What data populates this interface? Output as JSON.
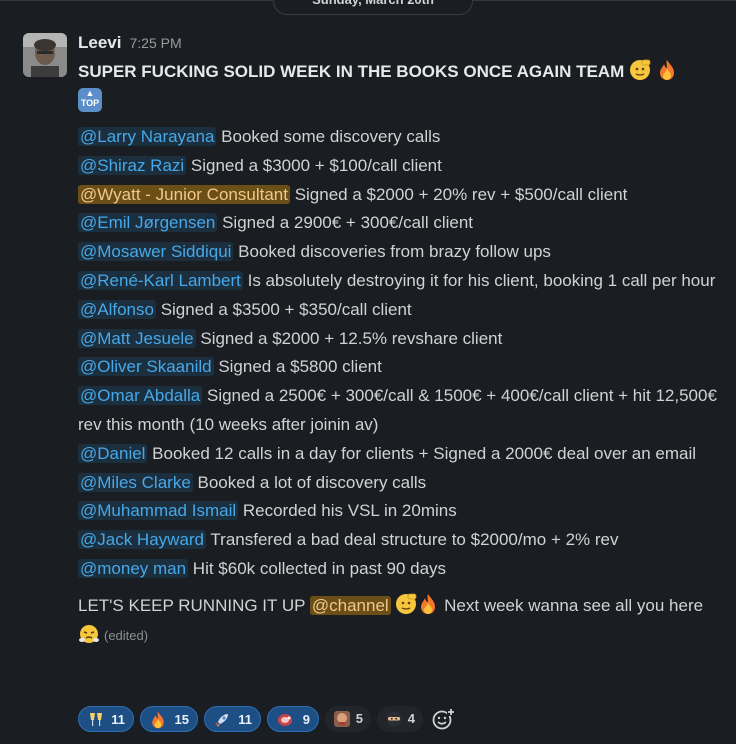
{
  "date_divider": "Sunday, March 20th",
  "message": {
    "author": "Leevi",
    "timestamp": "7:25 PM",
    "headline": "SUPER FUCKING SOLID WEEK IN THE BOOKS ONCE AGAIN TEAM",
    "headline_emojis": [
      "saluting-face",
      "fire",
      "top-arrow"
    ],
    "top_badge": "TOP",
    "items": [
      {
        "mention": "@Larry Narayana",
        "text": " Booked some discovery calls"
      },
      {
        "mention": "@Shiraz Razi",
        "text": " Signed a $3000 + $100/call client"
      },
      {
        "mention": "@Wyatt - Junior Consultant",
        "text": " Signed a $2000 + 20% rev + $500/call client",
        "highlight": true
      },
      {
        "mention": "@Emil Jørgensen",
        "text": " Signed a 2900€ + 300€/call client"
      },
      {
        "mention": "@Mosawer Siddiqui",
        "text": " Booked discoveries from brazy follow ups"
      },
      {
        "mention": "@René-Karl Lambert",
        "text": " Is absolutely destroying it for his client, booking 1 call per hour"
      },
      {
        "mention": "@Alfonso",
        "text": " Signed a $3500 + $350/call client"
      },
      {
        "mention": "@Matt Jesuele",
        "text": " Signed a $2000 + 12.5% revshare client"
      },
      {
        "mention": "@Oliver Skaanild",
        "text": " Signed a $5800 client"
      },
      {
        "mention": "@Omar Abdalla",
        "text": " Signed a 2500€ + 300€/call & 1500€ + 400€/call client + hit 12,500€ rev this month (10 weeks after joinin av)"
      },
      {
        "mention": "@Daniel",
        "text": " Booked 12 calls in a day for clients + Signed a 2000€ deal over an email"
      },
      {
        "mention": "@Miles Clarke",
        "text": " Booked a lot of discovery calls"
      },
      {
        "mention": "@Muhammad Ismail",
        "text": " Recorded his VSL in 20mins"
      },
      {
        "mention": "@Jack Hayward",
        "text": " Transfered a bad deal structure to $2000/mo + 2% rev"
      },
      {
        "mention": "@money man",
        "text": " Hit $60k collected in past 90 days"
      }
    ],
    "closing": {
      "before": "LET'S KEEP RUNNING IT UP ",
      "mention": "@channel",
      "after": " Next week wanna see all you here",
      "edited": "(edited)"
    }
  },
  "reactions": [
    {
      "emoji": "clinking-glasses",
      "count": "11",
      "active": true
    },
    {
      "emoji": "fire",
      "count": "15",
      "active": true
    },
    {
      "emoji": "rocket",
      "count": "11",
      "active": true
    },
    {
      "emoji": "meat",
      "count": "9",
      "active": true
    },
    {
      "emoji": "custom-face",
      "count": "5",
      "active": false
    },
    {
      "emoji": "ninja",
      "count": "4",
      "active": false
    }
  ],
  "add_reaction_icon": "add-reaction-icon",
  "colors": {
    "background": "#1a1d21",
    "mention": "#46a8e8",
    "mention_bg": "#1c2f3e",
    "self_mention_bg": "#6b4f17",
    "reaction_active": "#1d4f85"
  }
}
